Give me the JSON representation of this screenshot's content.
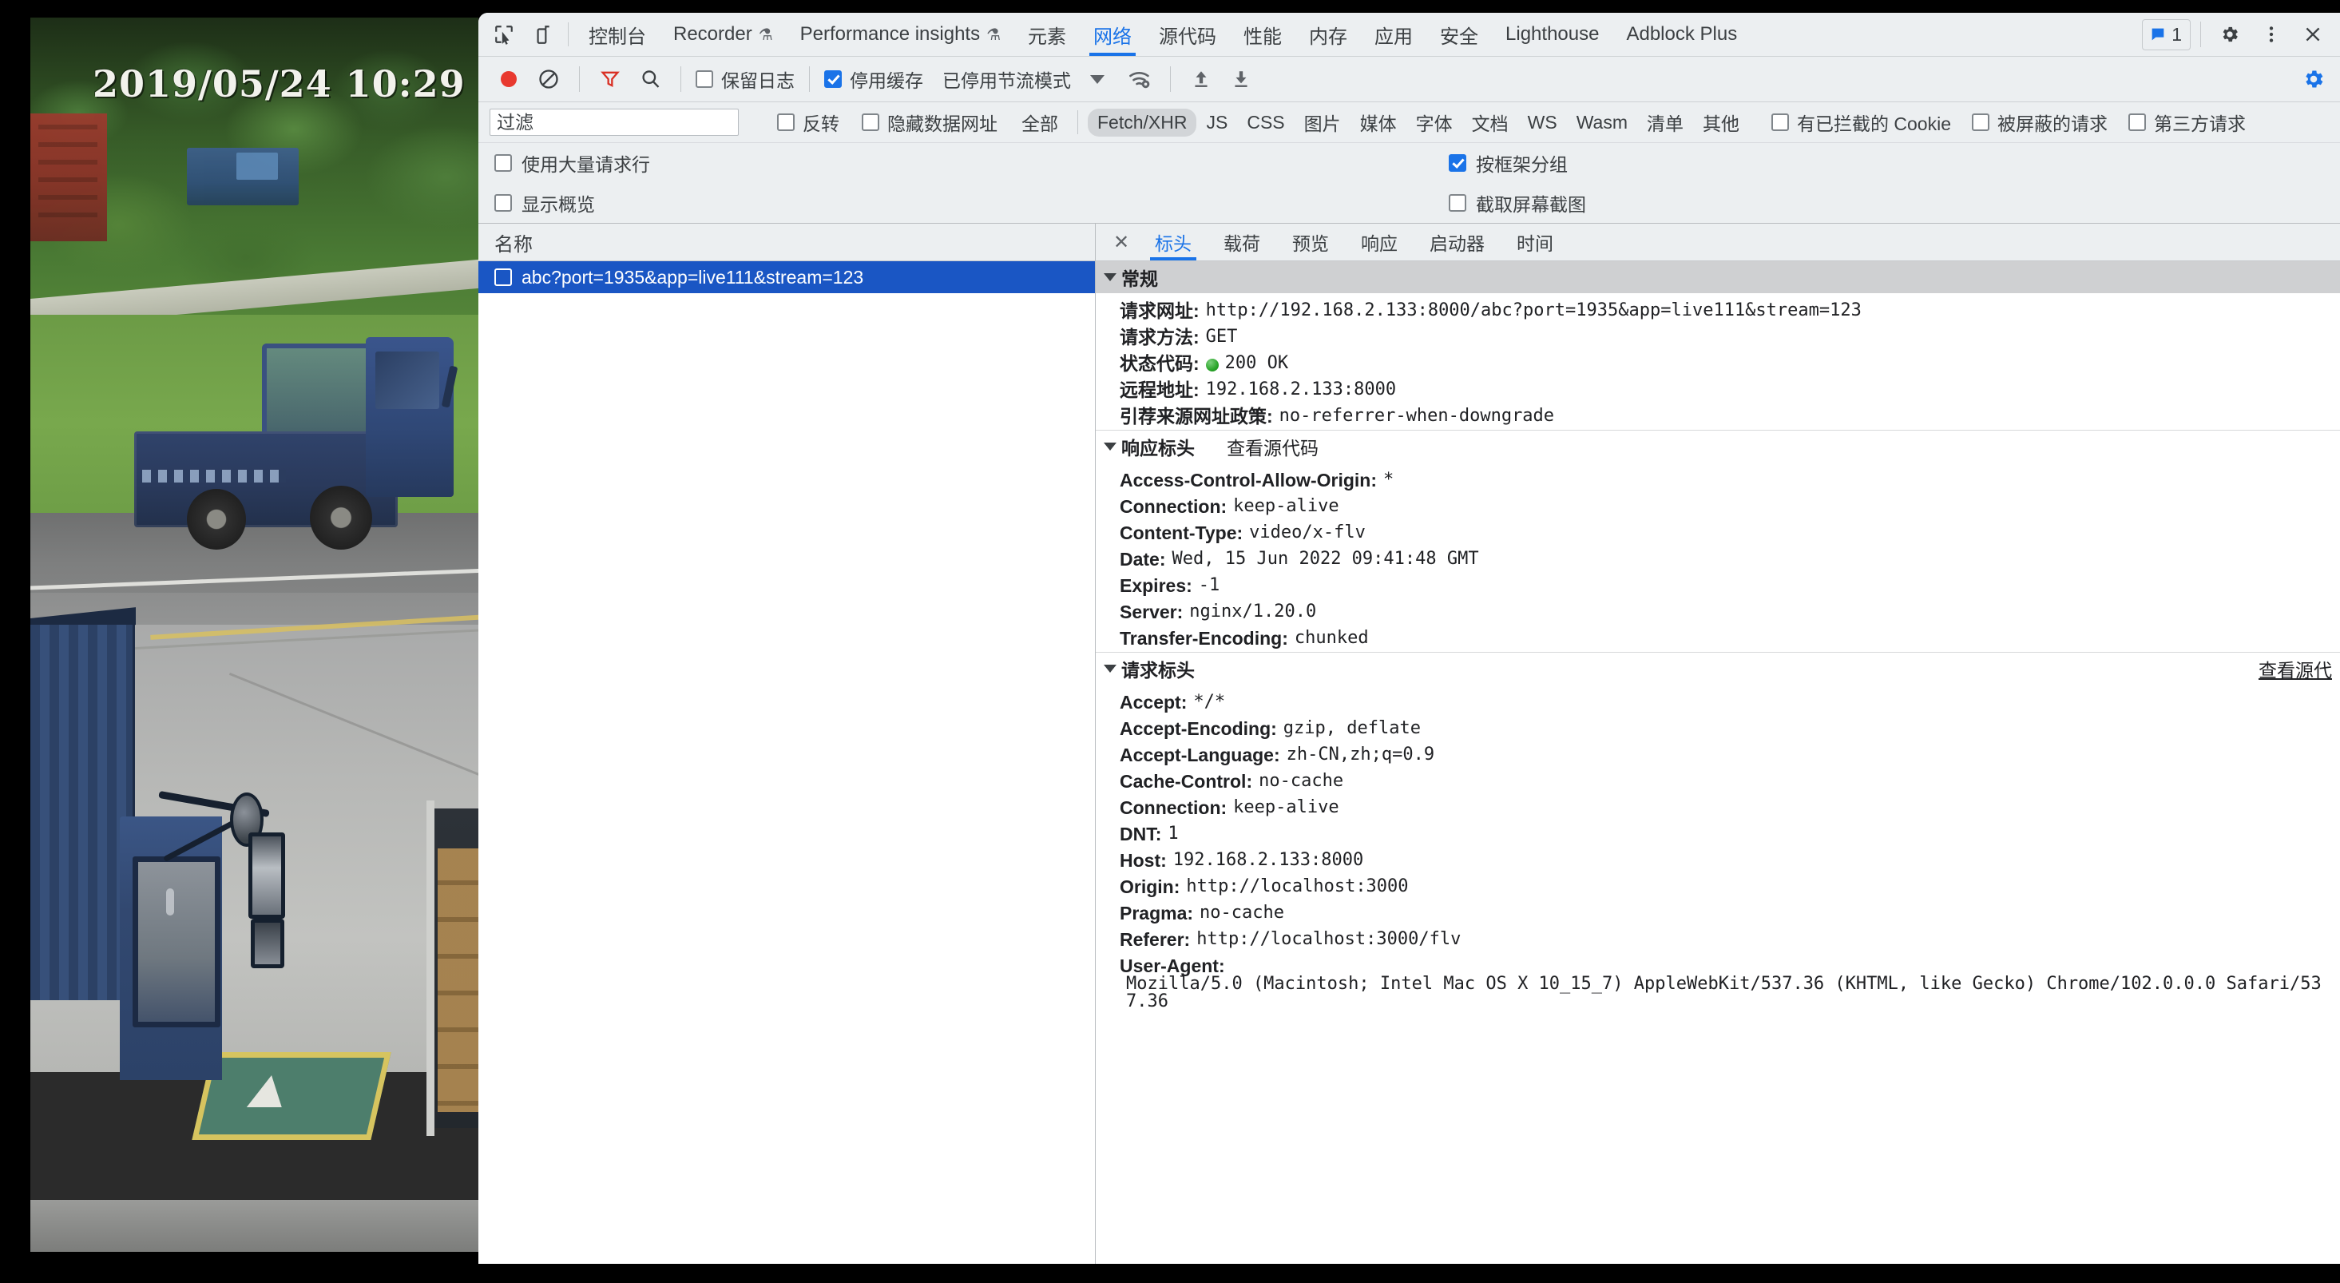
{
  "video": {
    "timestamp_overlay": "2019/05/24 10:29",
    "description": "live surveillance video of blue flatbed truck on road"
  },
  "devtools": {
    "tabstrip": {
      "inspect_icon": "inspect-element-icon",
      "device_icon": "device-toolbar-icon",
      "tabs": [
        {
          "label": "控制台",
          "warn": false,
          "active": false
        },
        {
          "label": "Recorder",
          "warn": true,
          "active": false
        },
        {
          "label": "Performance insights",
          "warn": true,
          "active": false
        },
        {
          "label": "元素",
          "warn": false,
          "active": false
        },
        {
          "label": "网络",
          "warn": false,
          "active": true
        },
        {
          "label": "源代码",
          "warn": false,
          "active": false
        },
        {
          "label": "性能",
          "warn": false,
          "active": false
        },
        {
          "label": "内存",
          "warn": false,
          "active": false
        },
        {
          "label": "应用",
          "warn": false,
          "active": false
        },
        {
          "label": "安全",
          "warn": false,
          "active": false
        },
        {
          "label": "Lighthouse",
          "warn": false,
          "active": false
        },
        {
          "label": "Adblock Plus",
          "warn": false,
          "active": false
        }
      ],
      "message_count": "1",
      "settings_icon": "gear-icon",
      "more_icon": "more-vertical-icon",
      "close_icon": "close-icon"
    },
    "toolbar": {
      "record_icon": "record-stop-icon",
      "clear_icon": "clear-icon",
      "filter_icon": "filter-funnel-icon",
      "search_icon": "search-icon",
      "preserve_log_label": "保留日志",
      "preserve_log_checked": false,
      "disable_cache_label": "停用缓存",
      "disable_cache_checked": true,
      "throttle_label": "已停用节流模式",
      "throttle_caret": "chevron-down-icon",
      "network_conditions_icon": "wifi-settings-icon",
      "import_har_icon": "upload-arrow-icon",
      "export_har_icon": "download-arrow-icon",
      "right_gear_icon": "gear-icon-blue"
    },
    "filterbar": {
      "filter_placeholder": "过滤",
      "filter_value": "",
      "invert_label": "反转",
      "invert_checked": false,
      "hide_data_urls_label": "隐藏数据网址",
      "hide_data_urls_checked": false,
      "types": [
        {
          "label": "全部",
          "selected": false
        },
        {
          "label": "Fetch/XHR",
          "selected": true
        },
        {
          "label": "JS",
          "selected": false
        },
        {
          "label": "CSS",
          "selected": false
        },
        {
          "label": "图片",
          "selected": false
        },
        {
          "label": "媒体",
          "selected": false
        },
        {
          "label": "字体",
          "selected": false
        },
        {
          "label": "文档",
          "selected": false
        },
        {
          "label": "WS",
          "selected": false
        },
        {
          "label": "Wasm",
          "selected": false
        },
        {
          "label": "清单",
          "selected": false
        },
        {
          "label": "其他",
          "selected": false
        }
      ],
      "blocked_cookies_label": "有已拦截的 Cookie",
      "blocked_cookies_checked": false,
      "blocked_requests_label": "被屏蔽的请求",
      "blocked_requests_checked": false,
      "third_party_label": "第三方请求",
      "third_party_checked": false
    },
    "options": {
      "big_request_rows_label": "使用大量请求行",
      "big_request_rows_checked": false,
      "group_by_frame_label": "按框架分组",
      "group_by_frame_checked": true,
      "show_overview_label": "显示概览",
      "show_overview_checked": false,
      "capture_screenshots_label": "截取屏幕截图",
      "capture_screenshots_checked": false
    },
    "request_list": {
      "column_header": "名称",
      "rows": [
        {
          "name": "abc?port=1935&app=live111&stream=123",
          "selected": true
        }
      ]
    },
    "detail": {
      "close_icon": "close-icon",
      "tabs": [
        {
          "label": "标头",
          "active": true
        },
        {
          "label": "载荷",
          "active": false
        },
        {
          "label": "预览",
          "active": false
        },
        {
          "label": "响应",
          "active": false
        },
        {
          "label": "启动器",
          "active": false
        },
        {
          "label": "时间",
          "active": false
        }
      ],
      "general": {
        "title": "常规",
        "rows": [
          {
            "key": "请求网址:",
            "value": "http://192.168.2.133:8000/abc?port=1935&app=live111&stream=123"
          },
          {
            "key": "请求方法:",
            "value": "GET"
          },
          {
            "key": "状态代码:",
            "value": "200 OK",
            "status_dot": true
          },
          {
            "key": "远程地址:",
            "value": "192.168.2.133:8000"
          },
          {
            "key": "引荐来源网址政策:",
            "value": "no-referrer-when-downgrade"
          }
        ]
      },
      "response_headers": {
        "title": "响应标头",
        "view_source_label": "查看源代码",
        "rows": [
          {
            "key": "Access-Control-Allow-Origin:",
            "value": "*"
          },
          {
            "key": "Connection:",
            "value": "keep-alive"
          },
          {
            "key": "Content-Type:",
            "value": "video/x-flv"
          },
          {
            "key": "Date:",
            "value": "Wed, 15 Jun 2022 09:41:48 GMT"
          },
          {
            "key": "Expires:",
            "value": "-1"
          },
          {
            "key": "Server:",
            "value": "nginx/1.20.0"
          },
          {
            "key": "Transfer-Encoding:",
            "value": "chunked"
          }
        ]
      },
      "request_headers": {
        "title": "请求标头",
        "view_source_label": "查看源代",
        "rows": [
          {
            "key": "Accept:",
            "value": "*/*"
          },
          {
            "key": "Accept-Encoding:",
            "value": "gzip, deflate"
          },
          {
            "key": "Accept-Language:",
            "value": "zh-CN,zh;q=0.9"
          },
          {
            "key": "Cache-Control:",
            "value": "no-cache"
          },
          {
            "key": "Connection:",
            "value": "keep-alive"
          },
          {
            "key": "DNT:",
            "value": "1"
          },
          {
            "key": "Host:",
            "value": "192.168.2.133:8000"
          },
          {
            "key": "Origin:",
            "value": "http://localhost:3000"
          },
          {
            "key": "Pragma:",
            "value": "no-cache"
          },
          {
            "key": "Referer:",
            "value": "http://localhost:3000/flv"
          },
          {
            "key": "User-Agent:",
            "value": "Mozilla/5.0 (Macintosh; Intel Mac OS X 10_15_7) AppleWebKit/537.36 (KHTML, like Gecko) Chrome/102.0.0.0 Safari/537.36"
          }
        ]
      }
    }
  },
  "colors": {
    "accent_blue": "#1a73e8",
    "selection_blue": "#1a56c4",
    "toolbar_bg": "#eceff1",
    "record_red": "#e8392f",
    "status_green": "#2aa52a"
  }
}
